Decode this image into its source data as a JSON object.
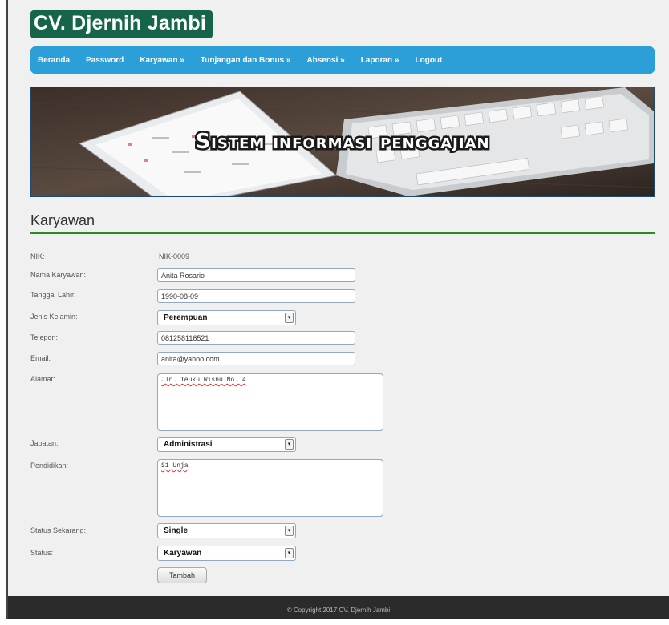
{
  "header": {
    "logo": "CV. Djernih Jambi"
  },
  "nav": {
    "items": [
      "Beranda",
      "Password",
      "Karyawan »",
      "Tunjangan dan Bonus »",
      "Absensi »",
      "Laporan »",
      "Logout"
    ]
  },
  "banner": {
    "title": "Sistem informasi penggajian"
  },
  "page": {
    "title": "Karyawan"
  },
  "form": {
    "nik": {
      "label": "NIK:",
      "value": "NIK-0009"
    },
    "nama": {
      "label": "Nama Karyawan:",
      "value": "Anita Rosario"
    },
    "tanggal_lahir": {
      "label": "Tanggal Lahir:",
      "value": "1990-08-09"
    },
    "jenis_kelamin": {
      "label": "Jenis Kelamin:",
      "value": "Perempuan"
    },
    "telepon": {
      "label": "Telepon:",
      "value": "081258116521"
    },
    "email": {
      "label": "Email:",
      "value": "anita@yahoo.com"
    },
    "alamat": {
      "label": "Alamat:",
      "value": "Jln. Teuku Wisnu No. 4"
    },
    "jabatan": {
      "label": "Jabatan:",
      "value": "Administrasi"
    },
    "pendidikan": {
      "label": "Pendidikan:",
      "value": "S1 Unja"
    },
    "status_sekarang": {
      "label": "Status Sekarang:",
      "value": "Single"
    },
    "status": {
      "label": "Status:",
      "value": "Karyawan"
    },
    "submit_label": "Tambah"
  },
  "footer": {
    "text": "© Copyright 2017 CV. Djernih Jambi"
  },
  "colors": {
    "logo_bg": "#16654a",
    "nav_bg": "#2c9fd9",
    "title_rule": "#2a8a2a",
    "footer_bg": "#2b2b2b"
  }
}
